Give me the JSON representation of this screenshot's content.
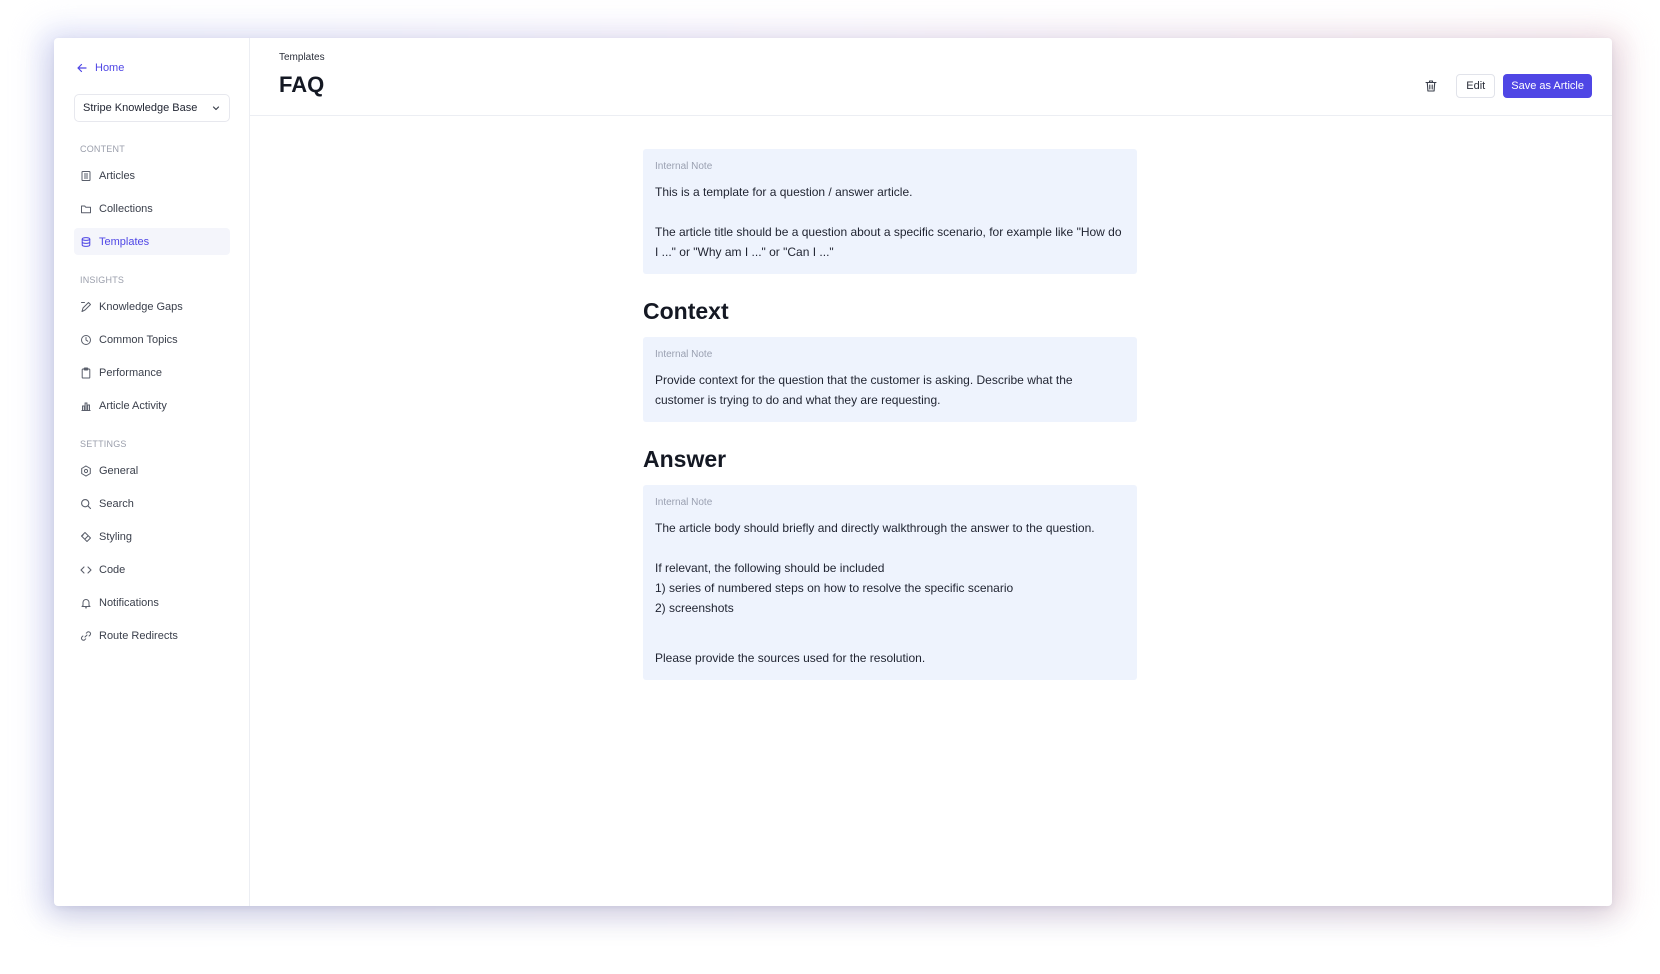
{
  "sidebar": {
    "home_label": "Home",
    "kb_selector": "Stripe Knowledge Base",
    "sections": {
      "content": "CONTENT",
      "insights": "INSIGHTS",
      "settings": "SETTINGS"
    },
    "content_items": [
      {
        "label": "Articles",
        "icon": "articles-icon"
      },
      {
        "label": "Collections",
        "icon": "folder-icon"
      },
      {
        "label": "Templates",
        "icon": "database-icon",
        "active": true
      }
    ],
    "insights_items": [
      {
        "label": "Knowledge Gaps",
        "icon": "pen-icon"
      },
      {
        "label": "Common Topics",
        "icon": "clock-icon"
      },
      {
        "label": "Performance",
        "icon": "clipboard-icon"
      },
      {
        "label": "Article Activity",
        "icon": "bar-chart-icon"
      }
    ],
    "settings_items": [
      {
        "label": "General",
        "icon": "gear-icon"
      },
      {
        "label": "Search",
        "icon": "search-icon"
      },
      {
        "label": "Styling",
        "icon": "paint-icon"
      },
      {
        "label": "Code",
        "icon": "code-icon"
      },
      {
        "label": "Notifications",
        "icon": "bell-icon"
      },
      {
        "label": "Route Redirects",
        "icon": "link-icon"
      }
    ]
  },
  "header": {
    "breadcrumb": "Templates",
    "title": "FAQ",
    "edit_label": "Edit",
    "save_label": "Save as Article"
  },
  "body": {
    "note_label": "Internal Note",
    "note1": {
      "p1": "This is a template for a question / answer article.",
      "p2": "The article title should be a question about a specific scenario, for example like \"How do I ...\" or \"Why am I ...\" or \"Can I ...\""
    },
    "context_heading": "Context",
    "note2": {
      "p1": "Provide context for the question that the customer is asking. Describe what the customer is trying to do and what they are requesting."
    },
    "answer_heading": "Answer",
    "note3": {
      "p1": "The article body should briefly and directly walkthrough the answer to the question.",
      "p2": "If relevant, the following should be included",
      "p3": "1) series of numbered steps on how to resolve the specific scenario",
      "p4": "2) screenshots",
      "p5": "Please provide the sources used for the resolution."
    }
  },
  "colors": {
    "accent": "#4f46e5",
    "note_bg": "#eef3fd",
    "active_bg": "#f4f5fb"
  }
}
